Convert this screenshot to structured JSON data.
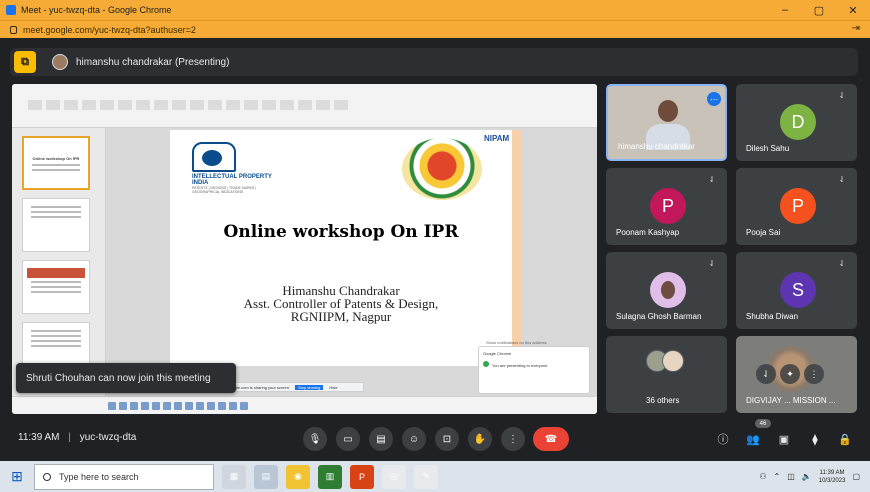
{
  "window": {
    "title": "Meet - yuc-twzq-dta - Google Chrome",
    "url": "meet.google.com/yuc-twzq-dta?authuser=2",
    "minimize": "–",
    "maximize": "▢",
    "close": "✕",
    "menu": "⇥"
  },
  "presenting": {
    "label": "himanshu chandrakar (Presenting)"
  },
  "slide": {
    "logo_text": "INTELLECTUAL PROPERTY INDIA",
    "logo_subtext": "PATENTS | DESIGNS | TRADE MARKS | GEOGRAPHICAL INDICATIONS",
    "brand_right": "NIPAM",
    "title": "Online workshop On IPR",
    "presenter_name": "Himanshu Chandrakar",
    "presenter_role": "Asst. Controller of Patents & Design,",
    "presenter_org": "RGNIIPM, Nagpur",
    "thumb1_title": "Online workshop On IPR"
  },
  "screen_share": {
    "share_text": "meet.google.com is sharing your screen",
    "stop_label": "Stop sharing",
    "hide_label": "Hide",
    "notif_title": "Google Chrome",
    "notif_text": "You are presenting to everyone",
    "link_text": "Show notifications on this address"
  },
  "toast": {
    "text": "Shruti Chouhan can now join this meeting"
  },
  "participants": [
    {
      "name": "himanshu chandrakar",
      "initial": "",
      "color": ""
    },
    {
      "name": "Dilesh Sahu",
      "initial": "D",
      "color": "#7cb342"
    },
    {
      "name": "Poonam Kashyap",
      "initial": "P",
      "color": "#c2185b"
    },
    {
      "name": "Pooja Sai",
      "initial": "P",
      "color": "#f4511e"
    },
    {
      "name": "Sulagna Ghosh Barman",
      "initial": "",
      "color": "#e1bee7"
    },
    {
      "name": "Shubha Diwan",
      "initial": "S",
      "color": "#5e35b1"
    },
    {
      "name": "36 others",
      "initial": "",
      "color": ""
    },
    {
      "name": "DIGVIJAY ... MISSION ...",
      "initial": "",
      "color": ""
    }
  ],
  "meeting_bar": {
    "time": "11:39 AM",
    "separator": "|",
    "code": "yuc-twzq-dta",
    "participant_count": "46"
  },
  "taskbar": {
    "search_placeholder": "Type here to search",
    "time": "11:39 AM",
    "date": "10/3/2023"
  }
}
